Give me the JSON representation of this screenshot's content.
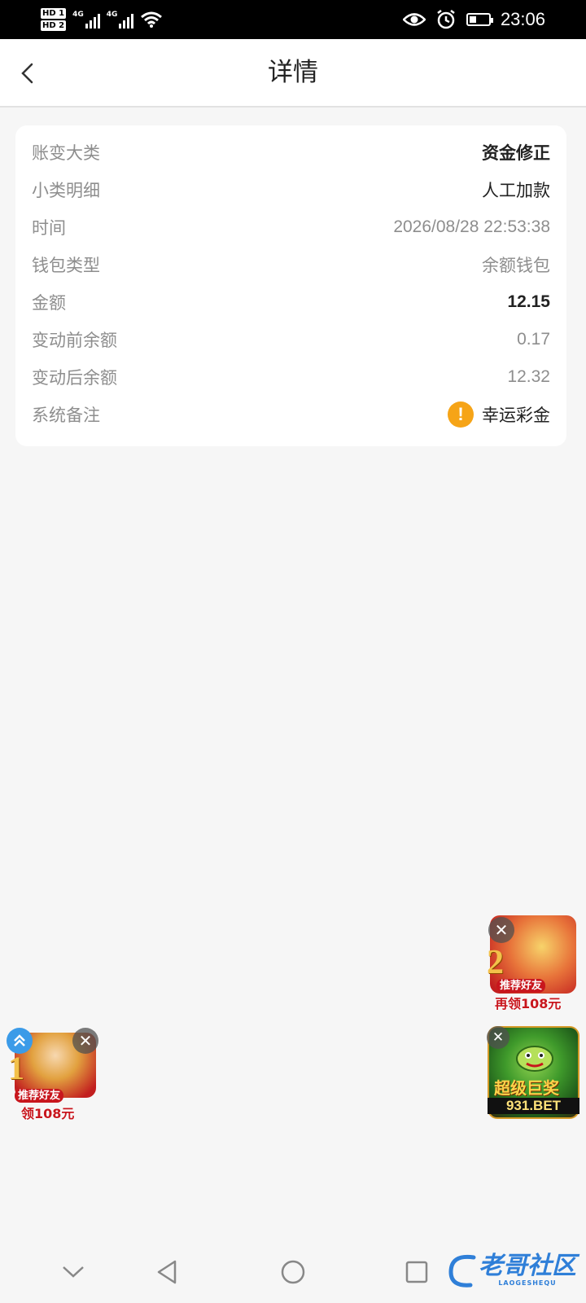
{
  "status_bar": {
    "sim1": "HD",
    "sim1_num": "1",
    "sim2": "HD",
    "sim2_num": "2",
    "net1": "4G",
    "net2": "4G",
    "battery_fraction": 0.35,
    "time": "23:06"
  },
  "header": {
    "title": "详情",
    "back_icon": "chevron-left-icon"
  },
  "details": [
    {
      "label": "账变大类",
      "value": "资金修正",
      "style": "bold"
    },
    {
      "label": "小类明细",
      "value": "人工加款",
      "style": "dark"
    },
    {
      "label": "时间",
      "value": "2026/08/28 22:53:38",
      "style": "muted"
    },
    {
      "label": "钱包类型",
      "value": "余额钱包",
      "style": "muted"
    },
    {
      "label": "金额",
      "value": "12.15",
      "style": "bold"
    },
    {
      "label": "变动前余额",
      "value": "0.17",
      "style": "muted"
    },
    {
      "label": "变动后余额",
      "value": "12.32",
      "style": "muted"
    }
  ],
  "note": {
    "label": "系统备注",
    "icon": "!",
    "value": "幸运彩金"
  },
  "ads": {
    "right_top": {
      "number": "2",
      "badge": "推荐好友",
      "sub": "再领108元"
    },
    "right_bottom": {
      "title": "超级巨奖",
      "site": "931.BET"
    },
    "left": {
      "number": "1",
      "badge": "推荐好友",
      "sub": "领108元"
    }
  },
  "close_glyph": "✕",
  "watermark": {
    "text": "老哥社区",
    "sub": "LAOGESHEQU"
  },
  "colors": {
    "accent": "#f6a417",
    "ad_red": "#c8161d",
    "watermark": "#2f7fd8"
  }
}
